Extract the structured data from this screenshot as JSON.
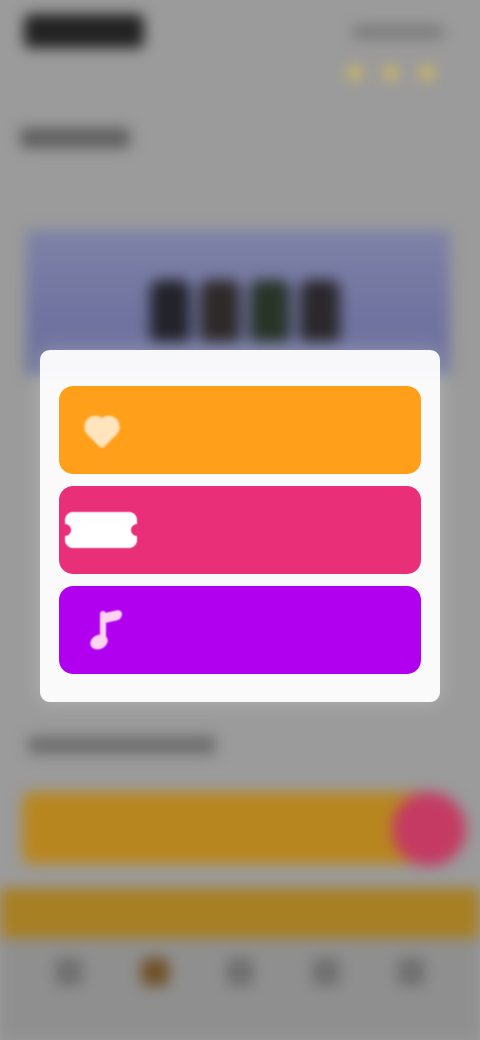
{
  "modal": {
    "options": [
      {
        "id": "orange",
        "label": "",
        "icon": "heart-icon",
        "color": "#ff9f1a"
      },
      {
        "id": "pink",
        "label": "",
        "icon": "ticket-icon",
        "color": "#ea2f79"
      },
      {
        "id": "purple",
        "label": "",
        "icon": "music-note-icon",
        "color": "#b100f0"
      }
    ]
  }
}
